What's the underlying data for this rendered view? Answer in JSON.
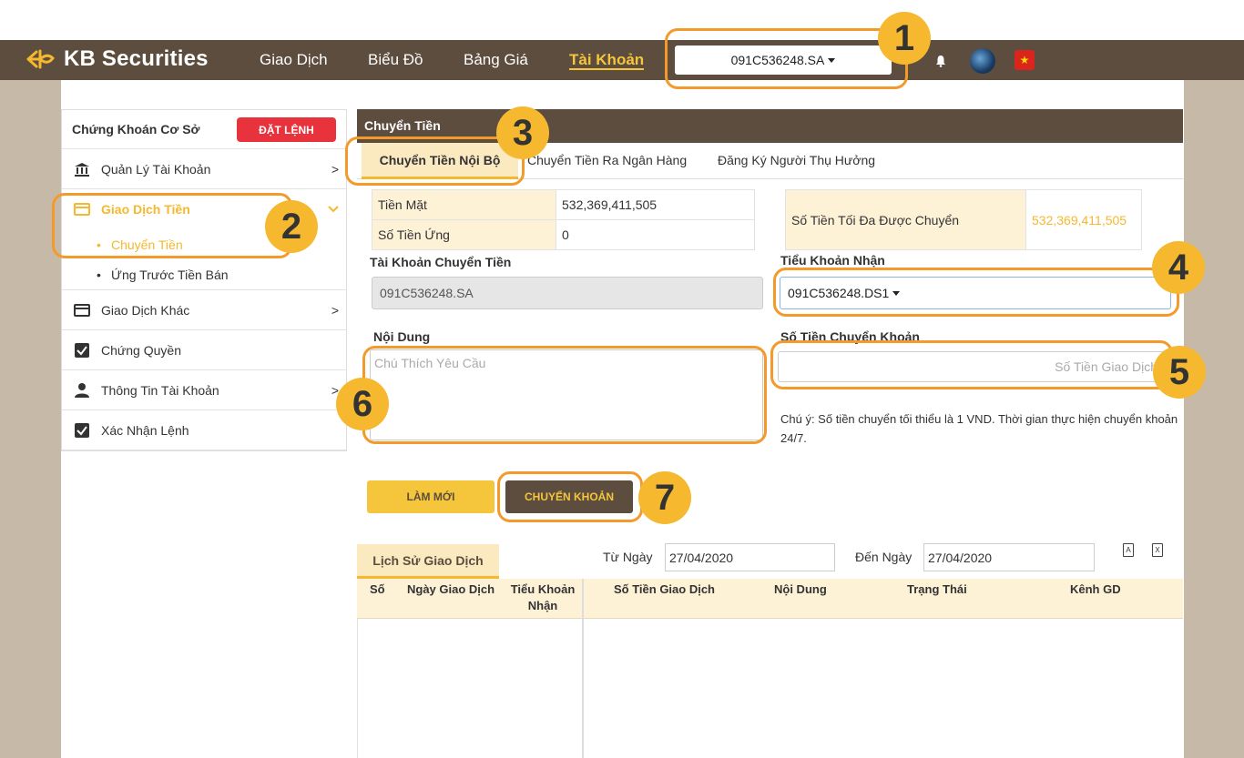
{
  "header": {
    "brand": "KB Securities",
    "nav": [
      "Giao Dịch",
      "Biểu Đồ",
      "Bảng Giá",
      "Tài Khoản"
    ],
    "active_nav": "Tài Khoản",
    "account": "091C536248.SA",
    "flag_glyph": "★"
  },
  "sidebar": {
    "title": "Chứng Khoán Cơ Sở",
    "order_button": "ĐẶT LỆNH",
    "items": [
      {
        "label": "Quản Lý Tài Khoản",
        "icon": "bank-icon"
      },
      {
        "label": "Giao Dịch Tiền",
        "icon": "card-icon"
      },
      {
        "label": "Chuyển Tiền",
        "icon": "bullet"
      },
      {
        "label": "Ứng Trước Tiền Bán",
        "icon": "bullet"
      },
      {
        "label": "Giao Dịch Khác",
        "icon": "card-icon"
      },
      {
        "label": "Chứng Quyền",
        "icon": "checkbox-icon"
      },
      {
        "label": "Thông Tin Tài Khoản",
        "icon": "user-icon"
      },
      {
        "label": "Xác Nhận Lệnh",
        "icon": "checkbox-icon"
      }
    ]
  },
  "panel": {
    "title": "Chuyển Tiền",
    "tabs": [
      "Chuyển Tiền Nội Bộ",
      "Chuyển Tiền Ra Ngân Hàng",
      "Đăng Ký Người Thụ Hưởng"
    ],
    "cash_label": "Tiền Mặt",
    "cash_value": "532,369,411,505",
    "advance_label": "Số Tiền Ứng",
    "advance_value": "0",
    "max_label": "Số Tiền Tối Đa Được Chuyển",
    "max_value": "532,369,411,505",
    "from_label": "Tài Khoản Chuyển Tiền",
    "from_value": "091C536248.SA",
    "to_label": "Tiểu Khoản Nhận",
    "to_value": "091C536248.DS1",
    "content_label": "Nội Dung",
    "content_placeholder": "Chú Thích Yêu Cầu",
    "amount_label": "Số Tiền Chuyển Khoản",
    "amount_placeholder": "Số Tiền Giao Dịch",
    "note": "Chú ý: Số tiền chuyển tối thiểu là 1 VND. Thời gian thực hiện chuyển khoản 24/7.",
    "refresh_button": "LÀM MỚI",
    "transfer_button": "CHUYỂN KHOẢN"
  },
  "history": {
    "tab": "Lịch Sử Giao Dịch",
    "from_label": "Từ Ngày",
    "from_date": "27/04/2020",
    "to_label": "Đến Ngày",
    "to_date": "27/04/2020",
    "columns": [
      "Số",
      "Ngày Giao Dịch",
      "Tiểu Khoản Nhận",
      "Số Tiền Giao Dịch",
      "Nội Dung",
      "Trạng Thái",
      "Kênh GD"
    ]
  },
  "callouts": [
    "1",
    "2",
    "3",
    "4",
    "5",
    "6",
    "7"
  ],
  "colors": {
    "topbar": "#5d4d3e",
    "accent": "#f5c53c",
    "callout": "#f5b82e",
    "order_red": "#e8323c",
    "page_side": "#c7b9a7"
  }
}
